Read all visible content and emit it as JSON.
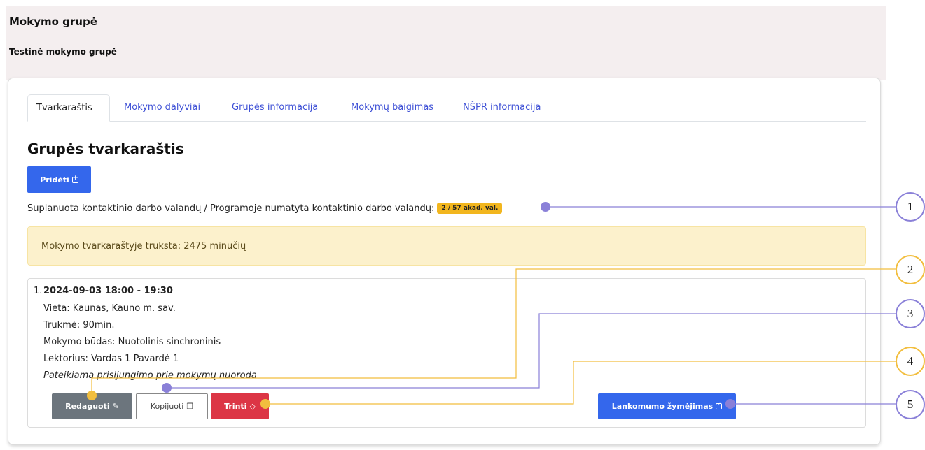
{
  "header": {
    "title": "Mokymo grupė",
    "subtitle": "Testinė mokymo grupė"
  },
  "tabs": [
    {
      "label": "Tvarkaraštis",
      "active": true
    },
    {
      "label": "Mokymo dalyviai",
      "active": false
    },
    {
      "label": "Grupės informacija",
      "active": false
    },
    {
      "label": "Mokymų baigimas",
      "active": false
    },
    {
      "label": "NŠPR informacija",
      "active": false
    }
  ],
  "section": {
    "title": "Grupės tvarkaraštis",
    "add_label": "Pridėti",
    "planned_text": "Suplanuota kontaktinio darbo valandų / Programoje numatyta kontaktinio darbo valandų:",
    "planned_badge": "2 / 57 akad. val.",
    "alert_text": "Mokymo tvarkaraštyje trūksta: 2475 minučių"
  },
  "entry": {
    "number": "1.",
    "when": "2024-09-03 18:00 - 19:30",
    "place": "Vieta: Kaunas, Kauno m. sav.",
    "duration": "Trukmė: 90min.",
    "mode": "Mokymo būdas: Nuotolinis sinchroninis",
    "lecturer": "Lektorius: Vardas 1 Pavardė 1",
    "note": "Pateikiama prisijungimo prie mokymų nuoroda",
    "edit_label": "Redaguoti",
    "copy_label": "Kopijuoti",
    "delete_label": "Trinti",
    "attendance_label": "Lankomumo žymėjimas"
  },
  "callouts": [
    "1",
    "2",
    "3",
    "4",
    "5"
  ],
  "colors": {
    "primary": "#3467ec",
    "secondary": "#6c757d",
    "danger": "#dc3545",
    "badge": "#f2b61e",
    "alert_bg": "#fcf1cc",
    "callout_purple": "#8a80d8",
    "callout_yellow": "#f2be3e"
  }
}
